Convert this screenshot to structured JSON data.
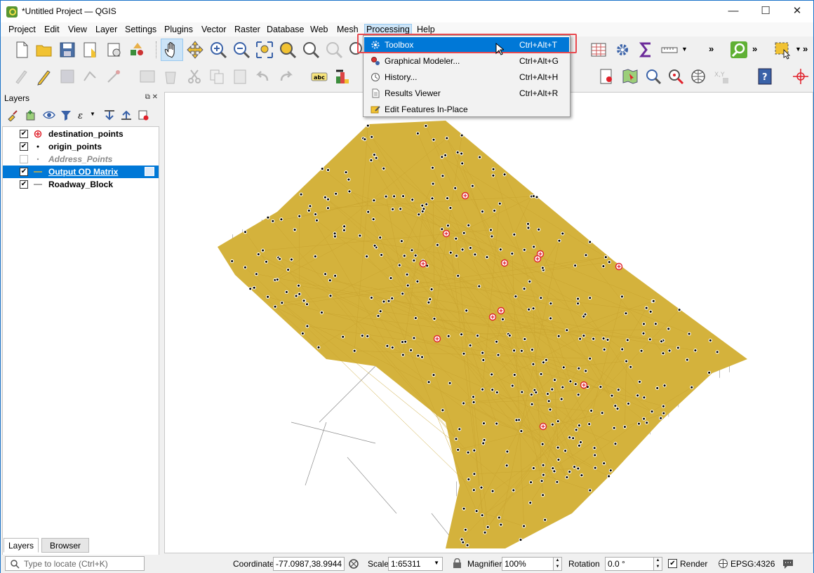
{
  "window": {
    "title": "*Untitled Project — QGIS",
    "controls": {
      "minimize": "—",
      "maximize": "☐",
      "close": "✕"
    }
  },
  "menubar": [
    "Project",
    "Edit",
    "View",
    "Layer",
    "Settings",
    "Plugins",
    "Vector",
    "Raster",
    "Database",
    "Web",
    "Mesh",
    "Processing",
    "Help"
  ],
  "processing_menu": {
    "items": [
      {
        "label": "Toolbox",
        "shortcut": "Ctrl+Alt+T",
        "icon": "gear-icon",
        "highlighted": true
      },
      {
        "label": "Graphical Modeler...",
        "shortcut": "Ctrl+Alt+G",
        "icon": "modeler-icon"
      },
      {
        "label": "History...",
        "shortcut": "Ctrl+Alt+H",
        "icon": "history-clock-icon"
      },
      {
        "label": "Results Viewer",
        "shortcut": "Ctrl+Alt+R",
        "icon": "document-icon"
      },
      {
        "label": "Edit Features In-Place",
        "shortcut": "",
        "icon": "edit-in-place-icon"
      }
    ]
  },
  "layers_panel": {
    "title": "Layers",
    "layers": [
      {
        "name": "destination_points",
        "checked": true,
        "symbol": "red-circle-cross",
        "selected": false,
        "italic": false
      },
      {
        "name": "origin_points",
        "checked": true,
        "symbol": "black-dot",
        "selected": false,
        "italic": false
      },
      {
        "name": "Address_Points",
        "checked": false,
        "symbol": "grey-dot",
        "selected": false,
        "italic": true
      },
      {
        "name": "Output OD Matrix",
        "checked": true,
        "symbol": "line",
        "selected": true,
        "italic": false
      },
      {
        "name": "Roadway_Block",
        "checked": true,
        "symbol": "grey-line",
        "selected": false,
        "italic": false
      }
    ],
    "tabs": [
      "Layers",
      "Browser"
    ]
  },
  "statusbar": {
    "locate_placeholder": "Type to locate (Ctrl+K)",
    "coordinate_label": "Coordinate",
    "coordinate_value": "-77.0987,38.9944",
    "scale_label": "Scale",
    "scale_value": "1:65311",
    "magnifier_label": "Magnifier",
    "magnifier_value": "100%",
    "rotation_label": "Rotation",
    "rotation_value": "0.0 °",
    "render_label": "Render",
    "render_checked": true,
    "crs": "EPSG:4326"
  },
  "colors": {
    "od_lines": "#d4b23c",
    "destination_points": "#e0212b",
    "origin_points": "#000000",
    "roads": "#8c8c8c",
    "highlight": "#0078d7",
    "callout": "#e8484e"
  }
}
